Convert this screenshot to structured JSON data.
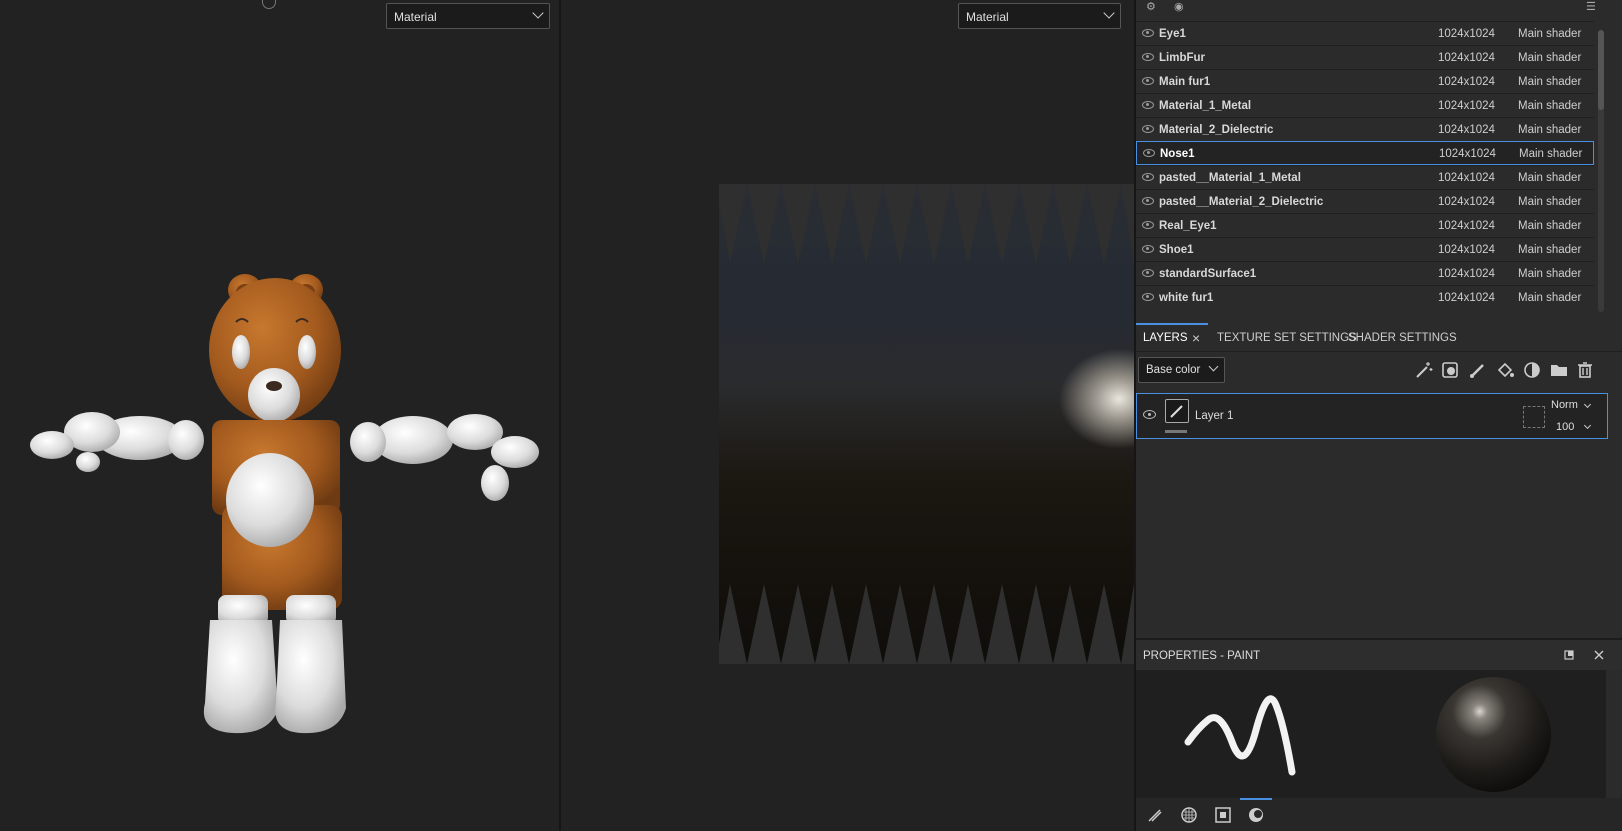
{
  "viewport3d": {
    "mode_select": "Material"
  },
  "viewport2d": {
    "mode_select": "Material"
  },
  "texture_sets": [
    {
      "name": "Eye1",
      "resolution": "1024x1024",
      "shader": "Main shader",
      "selected": false
    },
    {
      "name": "LimbFur",
      "resolution": "1024x1024",
      "shader": "Main shader",
      "selected": false
    },
    {
      "name": "Main fur1",
      "resolution": "1024x1024",
      "shader": "Main shader",
      "selected": false
    },
    {
      "name": "Material_1_Metal",
      "resolution": "1024x1024",
      "shader": "Main shader",
      "selected": false
    },
    {
      "name": "Material_2_Dielectric",
      "resolution": "1024x1024",
      "shader": "Main shader",
      "selected": false
    },
    {
      "name": "Nose1",
      "resolution": "1024x1024",
      "shader": "Main shader",
      "selected": true
    },
    {
      "name": "pasted__Material_1_Metal",
      "resolution": "1024x1024",
      "shader": "Main shader",
      "selected": false
    },
    {
      "name": "pasted__Material_2_Dielectric",
      "resolution": "1024x1024",
      "shader": "Main shader",
      "selected": false
    },
    {
      "name": "Real_Eye1",
      "resolution": "1024x1024",
      "shader": "Main shader",
      "selected": false
    },
    {
      "name": "Shoe1",
      "resolution": "1024x1024",
      "shader": "Main shader",
      "selected": false
    },
    {
      "name": "standardSurface1",
      "resolution": "1024x1024",
      "shader": "Main shader",
      "selected": false
    },
    {
      "name": "white fur1",
      "resolution": "1024x1024",
      "shader": "Main shader",
      "selected": false
    }
  ],
  "tabs": {
    "layers": "LAYERS",
    "texture_set_settings": "TEXTURE SET SETTINGS",
    "shader_settings": "SHADER SETTINGS"
  },
  "layers_toolbar": {
    "channel_select": "Base color",
    "icons": [
      "magic-wand-icon",
      "add-mask-icon",
      "paint-layer-icon",
      "fill-layer-icon",
      "smart-material-icon",
      "folder-icon",
      "trash-icon"
    ]
  },
  "layers": [
    {
      "name": "Layer 1",
      "blend_mode": "Norm",
      "opacity": "100"
    }
  ],
  "properties": {
    "title": "PROPERTIES - PAINT",
    "bottom_icons": [
      "brush-icon",
      "alpha-icon",
      "stencil-icon",
      "material-icon"
    ]
  },
  "colors": {
    "accent": "#4a90e2",
    "panel_bg": "#2b2b2b",
    "viewport_bg": "#222222",
    "bear_fur": "#a35a1e",
    "bear_white": "#e8e8e8"
  }
}
